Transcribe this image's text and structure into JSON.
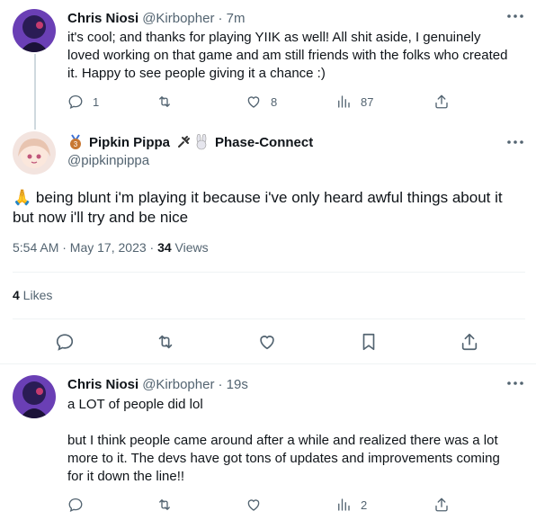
{
  "tweet1": {
    "name": "Chris Niosi",
    "handle": "@Kirbopher",
    "time": "· 7m",
    "text": "it's cool; and thanks for playing YIIK as well! All shit aside, I genuinely loved working on that game and am still friends with the folks who created it. Happy to see people giving it a chance :)",
    "replies": "1",
    "likes": "8",
    "views": "87"
  },
  "main": {
    "name": "Pipkin Pippa",
    "affiliation": "Phase-Connect",
    "handle": "@pipkinpippa",
    "text": "🙏 being blunt i'm playing it because i've only heard awful things about it but now i'll try and be nice",
    "timestamp": "5:54 AM · May 17, 2023 · ",
    "views_count": "34",
    "views_label": " Views",
    "likes_count": "4",
    "likes_label": " Likes"
  },
  "tweet3": {
    "name": "Chris Niosi",
    "handle": "@Kirbopher",
    "time": "· 19s",
    "line1": "a LOT of people did lol",
    "line2": "but I think people came around after a while and realized there was a lot more to it. The devs have got tons of updates and improvements coming for it down the line!!",
    "views": "2"
  },
  "colors": {
    "secondary": "#536471",
    "divider": "#eff3f4"
  }
}
